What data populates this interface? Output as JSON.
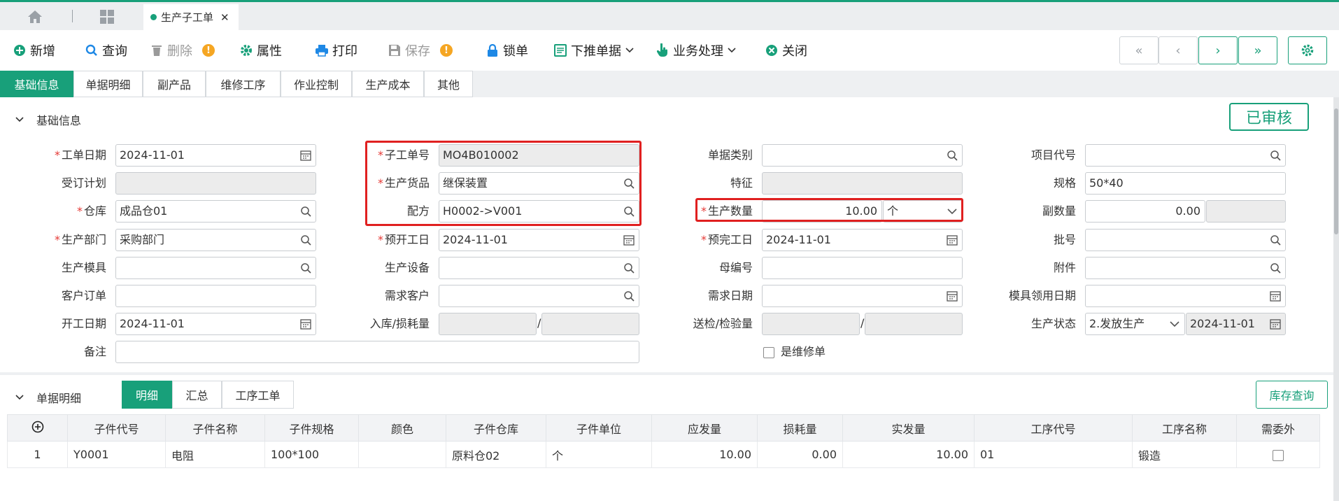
{
  "tabs": {
    "doc_tab_label": "生产子工单"
  },
  "toolbar": {
    "add": "新增",
    "query": "查询",
    "delete": "删除",
    "attr": "属性",
    "print": "打印",
    "save": "保存",
    "lock": "锁单",
    "push": "下推单据",
    "business": "业务处理",
    "close": "关闭"
  },
  "section_tabs": [
    "基础信息",
    "单据明细",
    "副产品",
    "维修工序",
    "作业控制",
    "生产成本",
    "其他"
  ],
  "base": {
    "header": "基础信息",
    "status_badge": "已审核",
    "labels": {
      "work_date": "工单日期",
      "order_plan": "受订计划",
      "warehouse": "仓库",
      "dept": "生产部门",
      "mold": "生产模具",
      "cust_order": "客户订单",
      "start_date": "开工日期",
      "remark": "备注",
      "sub_no": "子工单号",
      "goods": "生产货品",
      "formula": "配方",
      "plan_start": "预开工日",
      "equip": "生产设备",
      "demand_cust": "需求客户",
      "in_loss": "入库/损耗量",
      "doc_type": "单据类别",
      "feature": "特征",
      "qty": "生产数量",
      "plan_end": "预完工日",
      "parent_no": "母编号",
      "demand_date": "需求日期",
      "send_check": "送检/检验量",
      "is_repair": "是维修单",
      "proj_code": "项目代号",
      "spec": "规格",
      "sub_qty": "副数量",
      "batch": "批号",
      "attach": "附件",
      "mold_date": "模具领用日期",
      "prod_status": "生产状态"
    },
    "values": {
      "work_date": "2024-11-01",
      "warehouse": "成品仓01",
      "dept": "采购部门",
      "start_date": "2024-11-01",
      "sub_no": "MO4B010002",
      "goods": "继保装置",
      "formula": "H0002->V001",
      "plan_start": "2024-11-01",
      "qty": "10.00",
      "unit": "个",
      "plan_end": "2024-11-01",
      "spec": "50*40",
      "sub_qty": "0.00",
      "prod_status": "2.发放生产",
      "status_date": "2024-11-01"
    }
  },
  "detail": {
    "header": "单据明细",
    "subtabs": [
      "明细",
      "汇总",
      "工序工单"
    ],
    "stock_btn": "库存查询",
    "columns": [
      "子件代号",
      "子件名称",
      "子件规格",
      "颜色",
      "子件仓库",
      "子件单位",
      "应发量",
      "损耗量",
      "实发量",
      "工序代号",
      "工序名称",
      "需委外"
    ],
    "rows": [
      {
        "no": "1",
        "code": "Y0001",
        "name": "电阻",
        "spec": "100*100",
        "color": "",
        "wh": "原料仓02",
        "unit": "个",
        "due": "10.00",
        "loss": "0.00",
        "actual": "10.00",
        "proc_code": "01",
        "proc_name": "锻造"
      }
    ]
  }
}
